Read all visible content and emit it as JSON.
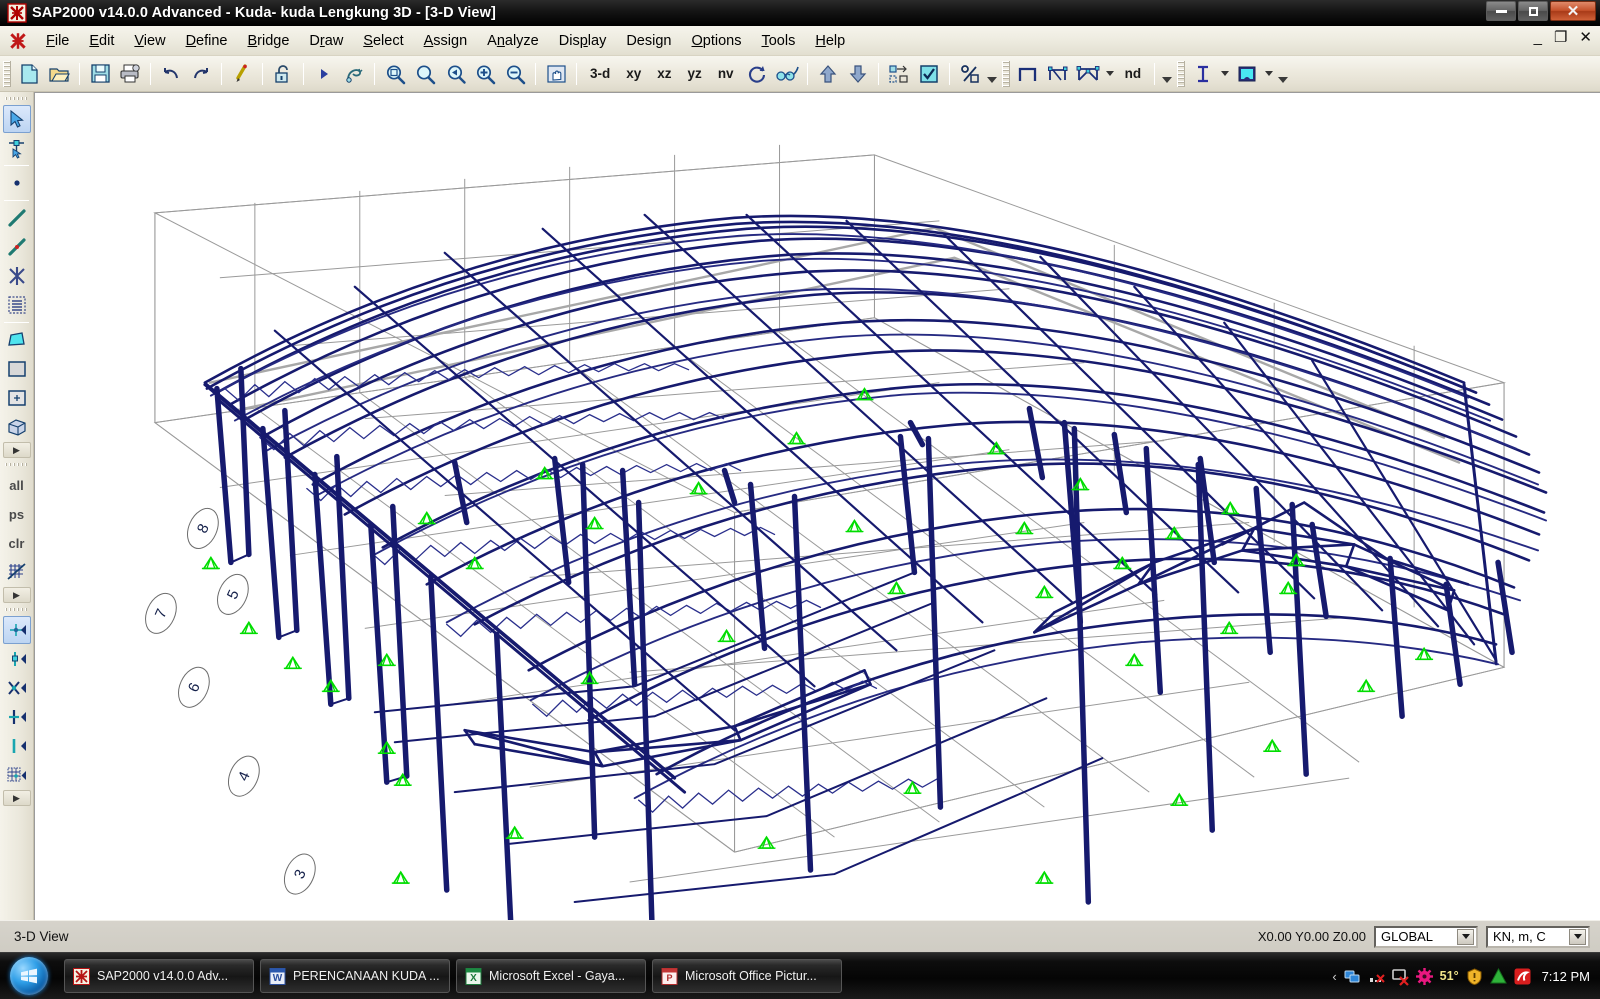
{
  "window": {
    "title": "SAP2000 v14.0.0 Advanced  - Kuda- kuda Lengkung 3D - [3-D View]",
    "app_icon": "sap2000-icon",
    "minimize_label": "–",
    "restore_label": "▣",
    "close_label": "✕"
  },
  "mdi": {
    "minimize_label": "_",
    "restore_label": "❐",
    "close_label": "✕"
  },
  "menu": {
    "items": [
      {
        "label": "File",
        "accel": "F"
      },
      {
        "label": "Edit",
        "accel": "E"
      },
      {
        "label": "View",
        "accel": "V"
      },
      {
        "label": "Define",
        "accel": "D"
      },
      {
        "label": "Bridge",
        "accel": "B"
      },
      {
        "label": "Draw",
        "accel": "r"
      },
      {
        "label": "Select",
        "accel": "S"
      },
      {
        "label": "Assign",
        "accel": "A"
      },
      {
        "label": "Analyze",
        "accel": "a"
      },
      {
        "label": "Display",
        "accel": "p"
      },
      {
        "label": "Design",
        "accel": "g"
      },
      {
        "label": "Options",
        "accel": "O"
      },
      {
        "label": "Tools",
        "accel": "T"
      },
      {
        "label": "Help",
        "accel": "H"
      }
    ]
  },
  "toolbar": {
    "buttons": [
      {
        "name": "new-model-icon",
        "label": ""
      },
      {
        "name": "open-file-icon",
        "label": ""
      },
      {
        "name": "save-icon",
        "label": ""
      },
      {
        "name": "print-icon",
        "label": ""
      },
      {
        "name": "undo-icon",
        "label": ""
      },
      {
        "name": "redo-icon",
        "label": ""
      },
      {
        "name": "refresh-window-icon",
        "label": ""
      },
      {
        "name": "lock-unlock-model-icon",
        "label": ""
      },
      {
        "name": "run-analysis-icon",
        "label": ""
      },
      {
        "name": "rubber-band-zoom-icon",
        "label": ""
      },
      {
        "name": "restore-full-view-icon",
        "label": ""
      },
      {
        "name": "previous-zoom-icon",
        "label": ""
      },
      {
        "name": "zoom-in-one-step-icon",
        "label": ""
      },
      {
        "name": "zoom-out-one-step-icon",
        "label": ""
      },
      {
        "name": "pan-icon",
        "label": ""
      },
      {
        "name": "view-3d-button",
        "label": "3-d"
      },
      {
        "name": "view-xy-button",
        "label": "xy"
      },
      {
        "name": "view-xz-button",
        "label": "xz"
      },
      {
        "name": "view-yz-button",
        "label": "yz"
      },
      {
        "name": "view-nv-button",
        "label": "nv"
      },
      {
        "name": "perspective-toggle-icon",
        "label": ""
      },
      {
        "name": "set-display-options-icon",
        "label": ""
      },
      {
        "name": "move-up-in-list-icon",
        "label": ""
      },
      {
        "name": "move-down-in-list-icon",
        "label": ""
      },
      {
        "name": "set-element-display-icon",
        "label": ""
      },
      {
        "name": "show-undeformed-shape-icon",
        "label": ""
      },
      {
        "name": "scale-percent-icon",
        "label": ""
      }
    ],
    "secondary_buttons": [
      {
        "name": "draw-frame-icon",
        "label": ""
      },
      {
        "name": "quick-draw-frame-icon",
        "label": ""
      },
      {
        "name": "quick-draw-brace-icon",
        "label": ""
      },
      {
        "name": "snap-nd-button",
        "label": "nd"
      }
    ],
    "tertiary_buttons": [
      {
        "name": "text-display-icon",
        "label": ""
      },
      {
        "name": "object-fill-color-icon",
        "label": ""
      }
    ]
  },
  "left_rail": {
    "group1": [
      {
        "name": "pointer-select-tool",
        "label": "",
        "active": true
      },
      {
        "name": "reshape-object-tool",
        "label": "",
        "active": false
      }
    ],
    "group2": [
      {
        "name": "draw-special-joint-tool",
        "label": "",
        "active": false
      },
      {
        "name": "draw-frame-cable-tool",
        "label": "",
        "active": false
      },
      {
        "name": "quick-draw-frame-tool",
        "label": "",
        "active": false
      },
      {
        "name": "quick-draw-brace-tool",
        "label": "",
        "active": false
      },
      {
        "name": "quick-draw-secondary-beam-tool",
        "label": "",
        "active": false
      }
    ],
    "group3": [
      {
        "name": "draw-poly-area-tool",
        "label": "",
        "active": false
      },
      {
        "name": "draw-rectangular-area-tool",
        "label": "",
        "active": false
      },
      {
        "name": "quick-draw-area-tool",
        "label": "",
        "active": false
      },
      {
        "name": "draw-solid-tool",
        "label": "",
        "active": false
      }
    ],
    "group4": [
      {
        "name": "select-all-tool",
        "label": "all",
        "active": false
      },
      {
        "name": "restore-previous-selection-tool",
        "label": "ps",
        "active": false
      },
      {
        "name": "clear-selection-tool",
        "label": "clr",
        "active": false
      },
      {
        "name": "deselect-grid-tool",
        "label": "",
        "active": false
      }
    ],
    "group5": [
      {
        "name": "snap-to-point-tool",
        "label": "",
        "active": true
      },
      {
        "name": "snap-to-joint-tool",
        "label": "",
        "active": false
      },
      {
        "name": "snap-to-intersection-tool",
        "label": "",
        "active": false
      },
      {
        "name": "snap-to-perpendicular-tool",
        "label": "",
        "active": false
      },
      {
        "name": "snap-to-line-end-tool",
        "label": "",
        "active": false
      },
      {
        "name": "snap-to-grid-tool",
        "label": "",
        "active": false
      }
    ],
    "more_label": "▸"
  },
  "model_view": {
    "view_name": "3-D View",
    "grid_labels": [
      "8",
      "7",
      "6",
      "5",
      "4",
      "3"
    ],
    "member_color": "#161a6e",
    "grid_color": "#8e8e8e",
    "support_color": "#00e000",
    "background_color": "#ffffff",
    "shadow_color": "#a9a9a9"
  },
  "status_bar": {
    "view_label": "3-D View",
    "coordinates": "X0.00  Y0.00  Z0.00",
    "coord_system": "GLOBAL",
    "units": "KN, m, C"
  },
  "taskbar": {
    "start_label": "Start",
    "items": [
      {
        "label": "SAP2000 v14.0.0 Adv...",
        "icon": "sap2000-icon"
      },
      {
        "label": "PERENCANAAN KUDA ...",
        "icon": "word-icon"
      },
      {
        "label": "Microsoft Excel - Gaya...",
        "icon": "excel-icon"
      },
      {
        "label": "Microsoft Office Pictur...",
        "icon": "picture-manager-icon"
      }
    ],
    "tray": {
      "expand_label": "‹",
      "icons": [
        "network-icon",
        "volume-muted-icon",
        "display-disconnected-icon",
        "settings-gear-icon"
      ],
      "temperature": "51°",
      "more_icons": [
        "warning-shield-icon",
        "green-triangle-icon",
        "avira-icon"
      ],
      "clock": "7:12 PM"
    }
  }
}
